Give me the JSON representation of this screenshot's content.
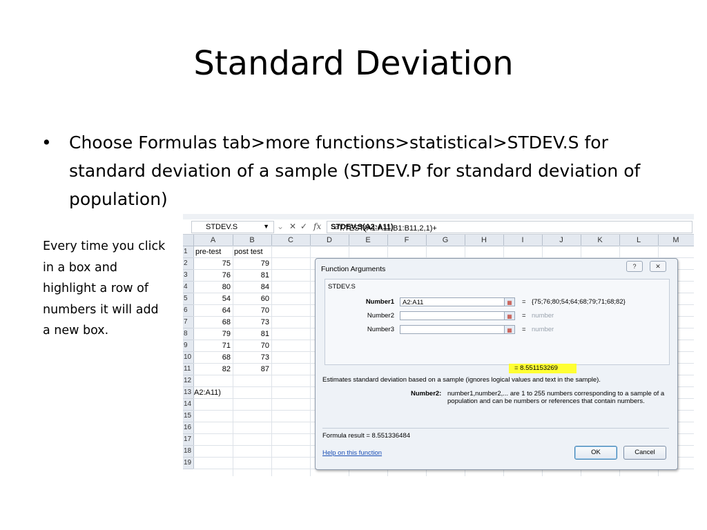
{
  "slide": {
    "title": "Standard Deviation",
    "bullet": "Choose Formulas tab>more functions>statistical>STDEV.S for standard deviation of a sample (STDEV.P for standard deviation of population)",
    "note": "Every time you click in a box and highlight a row of numbers it will add a new box."
  },
  "excel": {
    "name_box": "STDEV.S",
    "formula_prefix": "=T.TEST(A1:A11,B1:B11,2,1)+",
    "formula_bold": "STDEV.S(A2:A11)",
    "columns": [
      "A",
      "B",
      "C",
      "D",
      "E",
      "F",
      "G",
      "H",
      "I",
      "J",
      "K",
      "L",
      "M"
    ],
    "rows": [
      "1",
      "2",
      "3",
      "4",
      "5",
      "6",
      "7",
      "8",
      "9",
      "10",
      "11",
      "12",
      "13",
      "14",
      "15",
      "16",
      "17",
      "18",
      "19"
    ],
    "header_a": "pre-test",
    "header_b": "post test",
    "values_a": [
      "75",
      "76",
      "80",
      "54",
      "64",
      "68",
      "79",
      "71",
      "68",
      "82"
    ],
    "values_b": [
      "79",
      "81",
      "84",
      "60",
      "70",
      "73",
      "81",
      "70",
      "73",
      "87"
    ],
    "a13_text": "A2:A11)"
  },
  "dialog": {
    "title": "Function Arguments",
    "help_icon": "?",
    "close_icon": "✕",
    "function_name": "STDEV.S",
    "args": [
      {
        "label": "Number1",
        "value": "A2:A11",
        "result": "{75;76;80;54;64;68;79;71;68;82}"
      },
      {
        "label": "Number2",
        "value": "",
        "result": "number"
      },
      {
        "label": "Number3",
        "value": "",
        "result": "number"
      }
    ],
    "eq": "=",
    "result_line": "=  8.551153269",
    "description": "Estimates standard deviation based on a sample (ignores logical values and text in the sample).",
    "arg_name": "Number2:",
    "arg_help": "number1,number2,... are 1 to 255 numbers corresponding to a sample of a population and can be numbers or references that contain numbers.",
    "formula_result": "Formula result =   8.551336484",
    "help_link": "Help on this function",
    "ok": "OK",
    "cancel": "Cancel"
  }
}
